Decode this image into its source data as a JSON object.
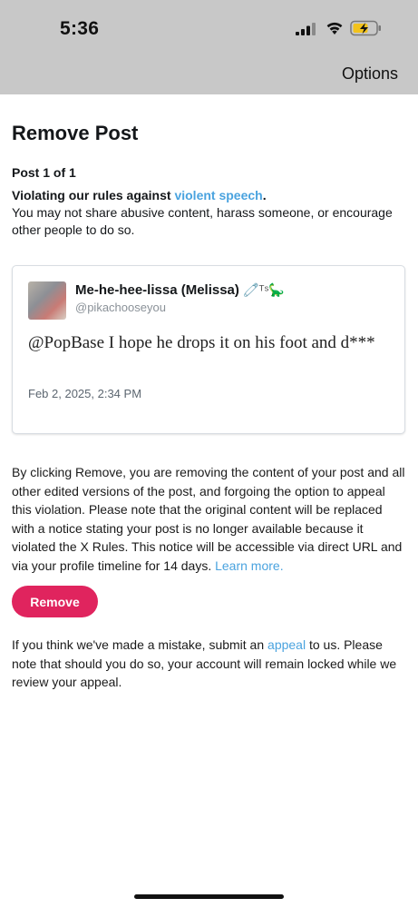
{
  "status_bar": {
    "time": "5:36"
  },
  "header": {
    "options_label": "Options"
  },
  "page": {
    "title": "Remove Post",
    "post_count": "Post 1 of 1",
    "rule_prefix": "Violating our rules against ",
    "rule_link": "violent speech",
    "rule_suffix": ".",
    "rule_description": "You may not share abusive content, harass someone, or encourage other people to do so."
  },
  "post": {
    "display_name": "Me-he-hee-lissa (Melissa)",
    "name_emoji": "🧷ᵀˢ🦕",
    "handle": "@pikachooseyou",
    "text": "@PopBase I hope he drops it on his foot and d***",
    "timestamp": "Feb 2, 2025, 2:34 PM"
  },
  "notice": {
    "text": "By clicking Remove, you are removing the content of your post and all other edited versions of the post, and forgoing the option to appeal this violation. Please note that the original content will be replaced with a notice stating your post is no longer available because it violated the X Rules. This notice will be accessible via direct URL and via your profile timeline for 14 days. ",
    "learn_more": "Learn more."
  },
  "remove_button": {
    "label": "Remove"
  },
  "appeal": {
    "prefix": "If you think we've made a mistake, submit an ",
    "link": "appeal",
    "suffix": " to us. Please note that should you do so, your account will remain locked while we review your appeal."
  },
  "colors": {
    "accent_link": "#4aa3df",
    "remove_button": "#e0245e",
    "status_bar_bg": "#c8c8c8"
  }
}
